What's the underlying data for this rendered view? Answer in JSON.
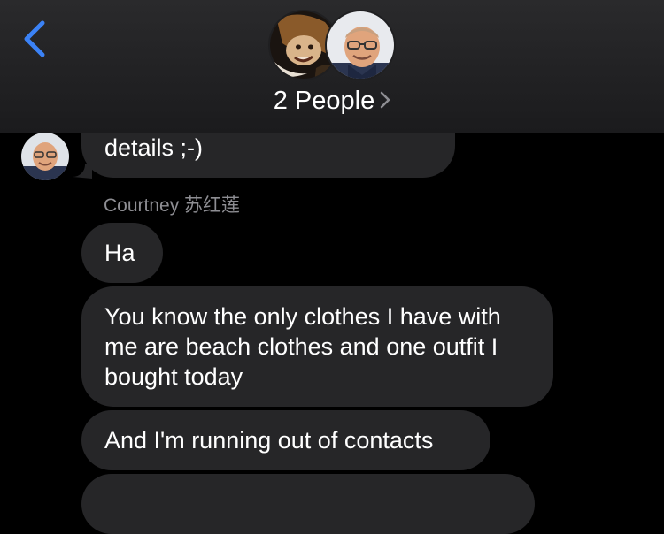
{
  "header": {
    "back_icon": "chevron-left-icon",
    "title": "2 People",
    "title_chevron_icon": "chevron-right-icon",
    "avatars": [
      "group-avatar-1",
      "group-avatar-2"
    ],
    "accent_color": "#3b82f6"
  },
  "messages": {
    "partial_message_text": "details ;-)",
    "sender_name": "Courtney 苏红莲",
    "items": [
      "Ha",
      "You know the only clothes I have with me are beach clothes and one outfit I bought today",
      "And I'm running out of contacts"
    ]
  },
  "colors": {
    "background": "#000000",
    "header_background": "#1f1f21",
    "bubble": "#262628",
    "sender_name": "#8e8e93"
  }
}
